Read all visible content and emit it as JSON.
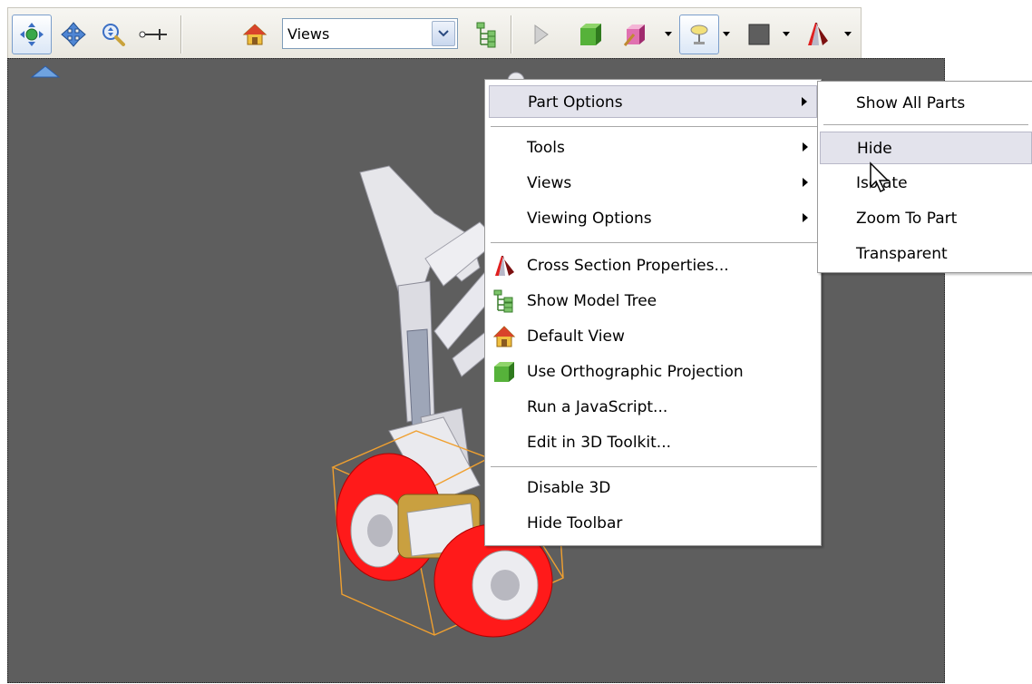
{
  "toolbar": {
    "tools": [
      {
        "name": "rotate-tool",
        "icon": "rotate-icon"
      },
      {
        "name": "pan-tool",
        "icon": "pan-icon"
      },
      {
        "name": "zoom-tool",
        "icon": "zoom-icon"
      },
      {
        "name": "measure-tool",
        "icon": "measure-icon"
      }
    ],
    "views_value": "Views",
    "accent": "#7b9ecb"
  },
  "context_menu": {
    "items": [
      {
        "label": "Part Options",
        "submenu": true,
        "icon": null
      },
      {
        "label": "Tools",
        "submenu": true,
        "icon": null
      },
      {
        "label": "Views",
        "submenu": true,
        "icon": null
      },
      {
        "label": "Viewing Options",
        "submenu": true,
        "icon": null
      },
      {
        "label": "Cross Section Properties...",
        "submenu": false,
        "icon": "cross-section-icon"
      },
      {
        "label": "Show Model Tree",
        "submenu": false,
        "icon": "model-tree-icon"
      },
      {
        "label": "Default View",
        "submenu": false,
        "icon": "home-icon"
      },
      {
        "label": "Use Orthographic Projection",
        "submenu": false,
        "icon": "cube-icon"
      },
      {
        "label": "Run a JavaScript...",
        "submenu": false,
        "icon": null
      },
      {
        "label": "Edit in 3D Toolkit...",
        "submenu": false,
        "icon": null
      },
      {
        "label": "Disable 3D",
        "submenu": false,
        "icon": null
      },
      {
        "label": "Hide Toolbar",
        "submenu": false,
        "icon": null
      }
    ],
    "highlighted": "Part Options"
  },
  "part_options_submenu": {
    "items": [
      {
        "label": "Show All Parts"
      },
      {
        "label": "Hide"
      },
      {
        "label": "Isolate"
      },
      {
        "label": "Zoom To Part"
      },
      {
        "label": "Transparent"
      }
    ],
    "highlighted": "Hide"
  },
  "viewport": {
    "background": "#5e5e5e",
    "selection_color": "#f0a030",
    "wheel_color": "#ff1a1a"
  }
}
